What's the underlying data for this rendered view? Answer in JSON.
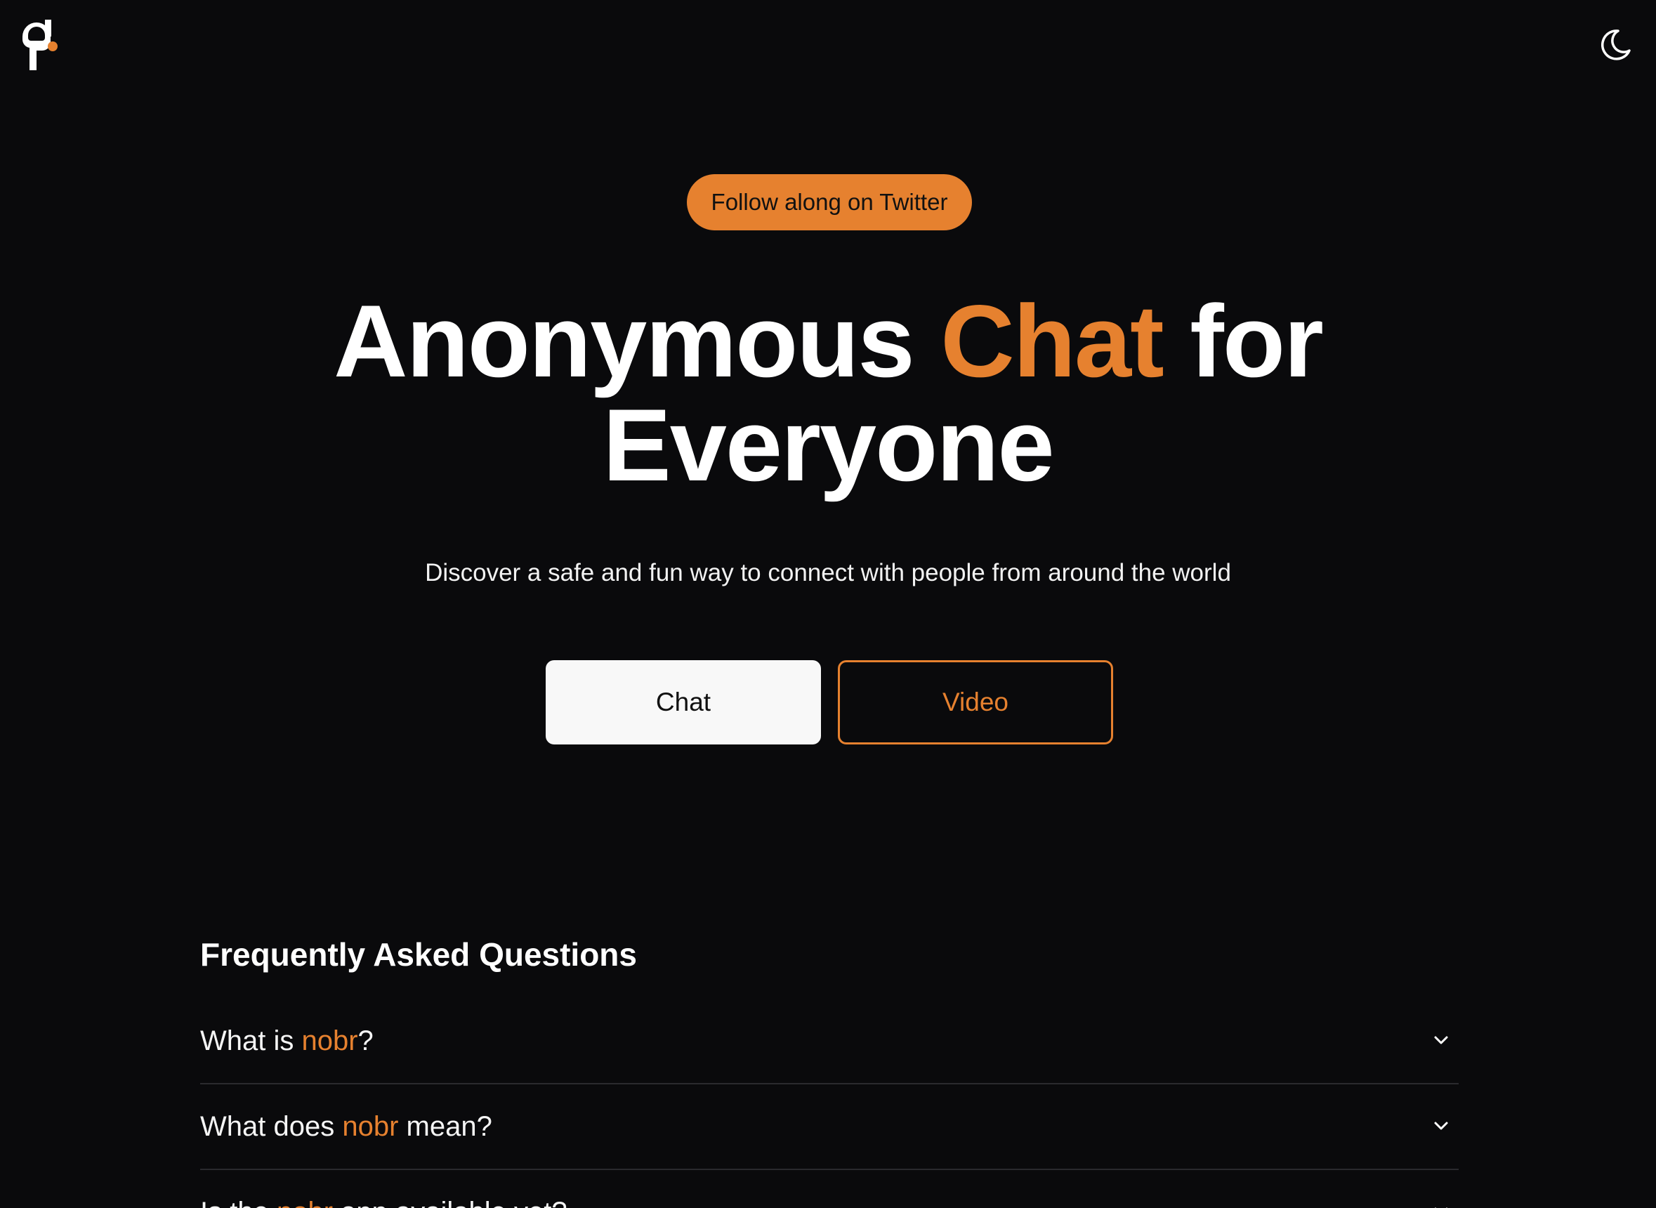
{
  "header": {
    "logo_icon": "nobr-logo-icon",
    "theme_toggle_icon": "moon-icon"
  },
  "hero": {
    "pill_label": "Follow along on Twitter",
    "title_part1": "Anonymous ",
    "title_accent": "Chat",
    "title_part2": " for",
    "title_line2": "Everyone",
    "subtitle": "Discover a safe and fun way to connect with people from around the world",
    "chat_button": "Chat",
    "video_button": "Video"
  },
  "faq": {
    "title": "Frequently Asked Questions",
    "items": [
      {
        "before": "What is ",
        "accent": "nobr",
        "after": "?"
      },
      {
        "before": "What does ",
        "accent": "nobr",
        "after": " mean?"
      },
      {
        "before": "Is the ",
        "accent": "nobr",
        "after": " app available yet?"
      }
    ]
  },
  "colors": {
    "background": "#0a0a0c",
    "accent": "#e6812f",
    "text": "#ffffff"
  }
}
